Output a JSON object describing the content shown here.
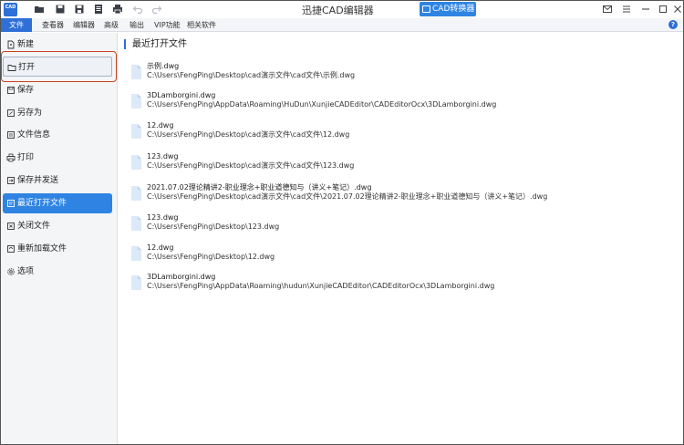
{
  "titlebar": {
    "app_logo_text": "CAD",
    "title": "迅捷CAD编辑器",
    "convert_button": "CAD转换器"
  },
  "quick_access": [
    "folder-icon",
    "save-icon",
    "save-as-icon",
    "saveall-icon",
    "print-icon",
    "undo-icon",
    "redo-icon"
  ],
  "menubar": {
    "items": [
      "文件",
      "查看器",
      "编辑器",
      "高级",
      "输出",
      "VIP功能",
      "相关软件"
    ],
    "active": "文件",
    "help_icon": "?"
  },
  "sidebar": {
    "items": [
      {
        "label": "新建",
        "icon": "new-icon"
      },
      {
        "label": "打开",
        "icon": "open-folder-icon"
      },
      {
        "label": "保存",
        "icon": "save-icon"
      },
      {
        "label": "另存为",
        "icon": "save-as-icon"
      },
      {
        "label": "文件信息",
        "icon": "file-info-icon"
      },
      {
        "label": "打印",
        "icon": "print-icon"
      },
      {
        "label": "保存并发送",
        "icon": "send-icon"
      },
      {
        "label": "最近打开文件",
        "icon": "recent-icon"
      },
      {
        "label": "关闭文件",
        "icon": "close-file-icon"
      },
      {
        "label": "重新加载文件",
        "icon": "reload-icon"
      },
      {
        "label": "选项",
        "icon": "options-gear-icon"
      }
    ],
    "selected": "最近打开文件",
    "highlighted": "打开"
  },
  "main": {
    "section_title": "最近打开文件",
    "files": [
      {
        "name": "示例.dwg",
        "path": "C:\\Users\\FengPing\\Desktop\\cad演示文件\\cad文件\\示例.dwg"
      },
      {
        "name": "3DLamborgini.dwg",
        "path": "C:\\Users\\FengPing\\AppData\\Roaming\\HuDun\\XunjieCADEditor\\CADEditorOcx\\3DLamborgini.dwg"
      },
      {
        "name": "12.dwg",
        "path": "C:\\Users\\FengPing\\Desktop\\cad演示文件\\cad文件\\12.dwg"
      },
      {
        "name": "123.dwg",
        "path": "C:\\Users\\FengPing\\Desktop\\cad演示文件\\cad文件\\123.dwg"
      },
      {
        "name": "2021.07.02理论精讲2-职业理念+职业道德知与（讲义+笔记）.dwg",
        "path": "C:\\Users\\FengPing\\Desktop\\cad演示文件\\cad文件\\2021.07.02理论精讲2-职业理念+职业道德知与（讲义+笔记）.dwg"
      },
      {
        "name": "123.dwg",
        "path": "C:\\Users\\FengPing\\Desktop\\123.dwg"
      },
      {
        "name": "12.dwg",
        "path": "C:\\Users\\FengPing\\Desktop\\12.dwg"
      },
      {
        "name": "3DLamborgini.dwg",
        "path": "C:\\Users\\FengPing\\AppData\\Roaming\\hudun\\XunjieCADEditor\\CADEditorOcx\\3DLamborgini.dwg"
      }
    ]
  },
  "colors": {
    "accent": "#2f6fd6",
    "selected_bg": "#2f84e3",
    "annotation": "#c9421f"
  }
}
